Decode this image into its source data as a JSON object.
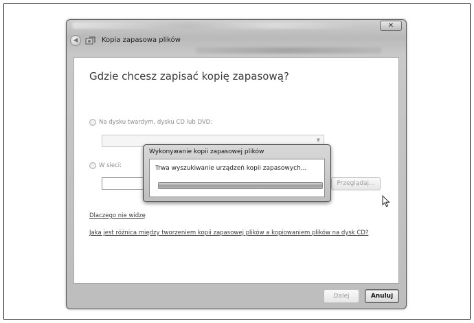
{
  "window": {
    "title": "Kopia zapasowa plików",
    "close_glyph": "✕"
  },
  "icons": {
    "back": "back-arrow-icon",
    "app": "backup-app-icon",
    "close": "close-icon",
    "dropdown": "chevron-down-icon",
    "cursor": "mouse-pointer-icon"
  },
  "main": {
    "heading": "Gdzie chcesz zapisać kopię zapasową?",
    "option_local_label": "Na dysku twardym, dysku CD lub DVD:",
    "option_network_label": "W sieci:",
    "network_path_value": "",
    "browse_label": "Przeglądaj...",
    "link_why": "Dlaczego nie widzę",
    "link_difference": "Jaka jest różnica między tworzeniem kopii zapasowej plików a kopiowaniem plików na dysk CD?"
  },
  "footer": {
    "next_label": "Dalej",
    "cancel_label": "Anuluj"
  },
  "progress_dialog": {
    "title": "Wykonywanie kopii zapasowej plików",
    "message": "Trwa wyszukiwanie urządzeń kopii zapasowych...",
    "progress_fraction": 1.0
  },
  "colors": {
    "frame": "#c3c3c3",
    "content_bg": "#ffffff",
    "text_disabled": "#8a8a8a"
  }
}
